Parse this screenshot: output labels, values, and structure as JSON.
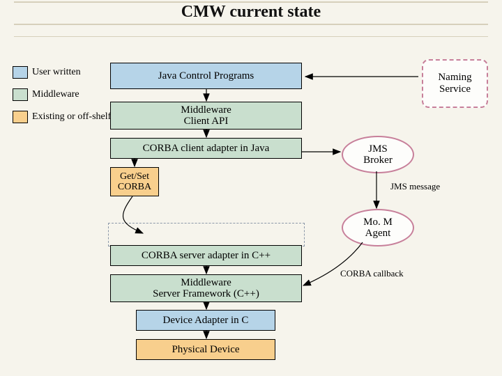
{
  "title": "CMW current state",
  "legend": {
    "user": "User written",
    "middleware": "Middleware",
    "offshelf": "Existing or off-shelf"
  },
  "boxes": {
    "java_control": "Java Control Programs",
    "mw_client_api": "Middleware\nClient API",
    "corba_client_adapter": "CORBA client adapter in Java",
    "getset_corba": "Get/Set\nCORBA",
    "corba_server_adapter": "CORBA server adapter in C++",
    "mw_server_fw": "Middleware\nServer Framework (C++)",
    "device_adapter": "Device Adapter in C",
    "physical_device": "Physical Device",
    "naming_service": "Naming\nService"
  },
  "ellipses": {
    "jms_broker": "JMS\nBroker",
    "mom_agent": "Mo. M\nAgent"
  },
  "labels": {
    "jms_message": "JMS message",
    "corba_callback": "CORBA callback"
  }
}
